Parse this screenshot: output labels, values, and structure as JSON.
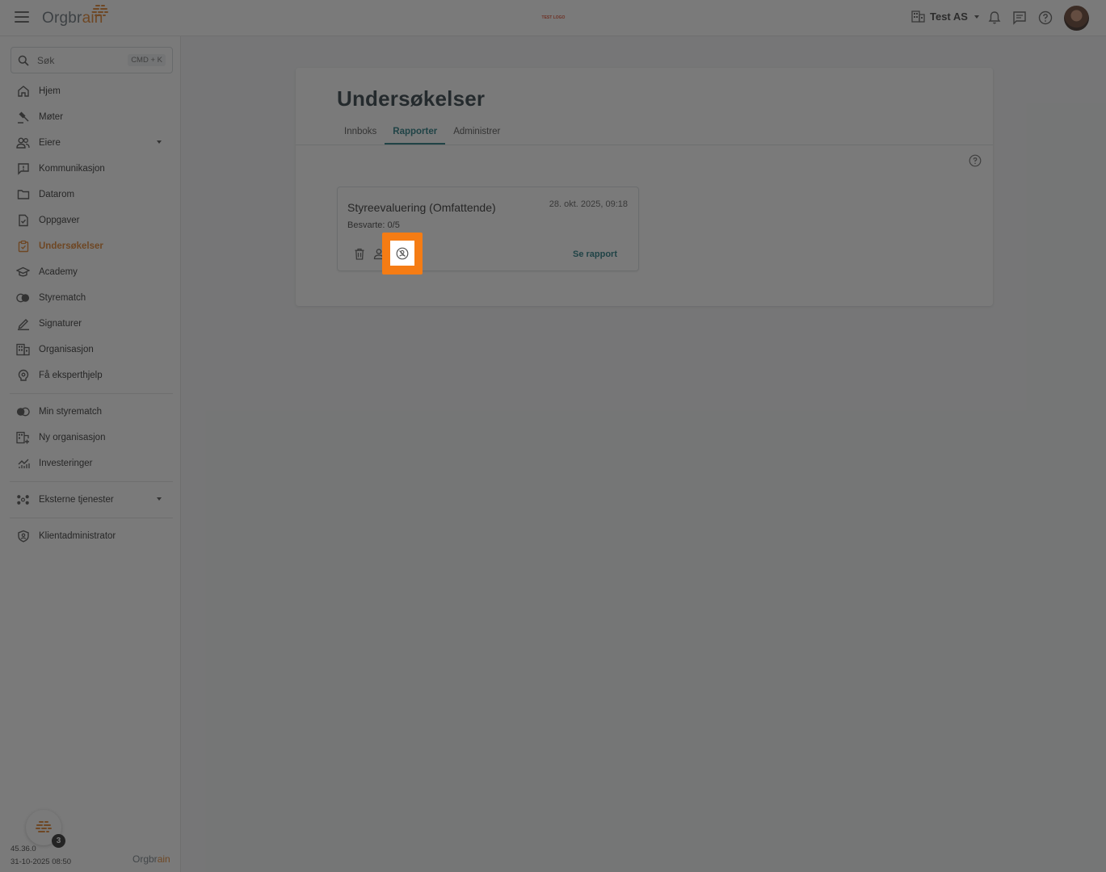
{
  "app": {
    "brand_main": "Orgbr",
    "brand_accent": "ain",
    "test_logo": "TEST LOGO",
    "org_name": "Test AS",
    "accent_color": "#e07a1f",
    "teal_color": "#136f78"
  },
  "search": {
    "placeholder": "Søk",
    "shortcut": "CMD + K"
  },
  "sidebar": {
    "items": [
      {
        "label": "Hjem",
        "icon": "home-icon"
      },
      {
        "label": "Møter",
        "icon": "gavel-icon"
      },
      {
        "label": "Eiere",
        "icon": "people-icon"
      },
      {
        "label": "Kommunikasjon",
        "icon": "message-alert-icon"
      },
      {
        "label": "Datarom",
        "icon": "folder-icon"
      },
      {
        "label": "Oppgaver",
        "icon": "task-icon"
      },
      {
        "label": "Undersøkelser",
        "icon": "survey-icon"
      },
      {
        "label": "Academy",
        "icon": "academy-icon"
      },
      {
        "label": "Styrematch",
        "icon": "match-icon"
      },
      {
        "label": "Signaturer",
        "icon": "signature-icon"
      },
      {
        "label": "Organisasjon",
        "icon": "building-icon"
      },
      {
        "label": "Få eksperthjelp",
        "icon": "expert-icon"
      }
    ],
    "secondary": [
      {
        "label": "Min styrematch",
        "icon": "match-icon"
      },
      {
        "label": "Ny organisasjon",
        "icon": "add-building-icon"
      },
      {
        "label": "Investeringer",
        "icon": "chart-icon"
      }
    ],
    "external": {
      "label": "Eksterne tjenester",
      "icon": "hub-icon"
    },
    "admin": {
      "label": "Klientadministrator",
      "icon": "shield-icon"
    },
    "support_badge": "3",
    "version": "45.36.0",
    "build_date": "31-10-2025 08:50"
  },
  "main": {
    "title": "Undersøkelser",
    "tabs": [
      {
        "label": "Innboks"
      },
      {
        "label": "Rapporter"
      },
      {
        "label": "Administrer"
      }
    ],
    "card": {
      "title": "Styreevaluering (Omfattende)",
      "date": "28. okt. 2025, 09:18",
      "answered": "Besvarte: 0/5",
      "report_link": "Se rapport"
    }
  }
}
